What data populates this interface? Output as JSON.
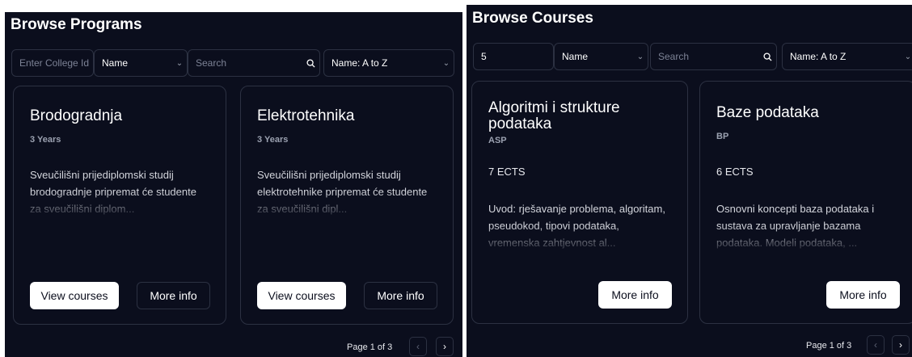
{
  "programs": {
    "title": "Browse Programs",
    "filters": {
      "college_placeholder": "Enter College Id",
      "sort_field": "Name",
      "search_placeholder": "Search",
      "sort_order": "Name: A to Z"
    },
    "cards": [
      {
        "title": "Brodogradnja",
        "duration": "3 Years",
        "description": "Sveučilišni prijediplomski studij\nbrodogradnje pripremat će studente\nza sveučilišni diplom...",
        "view_courses_label": "View courses",
        "more_info_label": "More info"
      },
      {
        "title": "Elektrotehnika",
        "duration": "3 Years",
        "description": "Sveučilišni prijediplomski studij\nelektrotehnike pripremat će studente\nza sveučilišni dipl...",
        "view_courses_label": "View courses",
        "more_info_label": "More info"
      }
    ],
    "pagination": {
      "label": "Page 1 of 3"
    }
  },
  "courses": {
    "title": "Browse Courses",
    "filters": {
      "program_id_value": "5",
      "sort_field": "Name",
      "search_placeholder": "Search",
      "sort_order": "Name: A to Z"
    },
    "cards": [
      {
        "title": "Algoritmi i strukture\npodataka",
        "code": "ASP",
        "ects": "7 ECTS",
        "description": "Uvod: rješavanje problema, algoritam,\npseudokod, tipovi podataka,\nvremenska zahtjevnost al...",
        "more_info_label": "More info"
      },
      {
        "title": "Baze podataka",
        "code": "BP",
        "ects": "6 ECTS",
        "description": "Osnovni koncepti baza podataka i\nsustava za upravljanje bazama\npodataka. Modeli podataka, ...",
        "more_info_label": "More info"
      }
    ],
    "pagination": {
      "label": "Page 1 of 3"
    }
  },
  "icons": {
    "search": "search-icon",
    "chevron": "chevron-down-icon",
    "prev": "chevron-left-icon",
    "next": "chevron-right-icon"
  },
  "colors": {
    "background": "#0b0e1d",
    "border": "#2c3142",
    "text": "#ffffff",
    "muted_text": "#9ba1b0",
    "button_light": "#ffffff"
  }
}
